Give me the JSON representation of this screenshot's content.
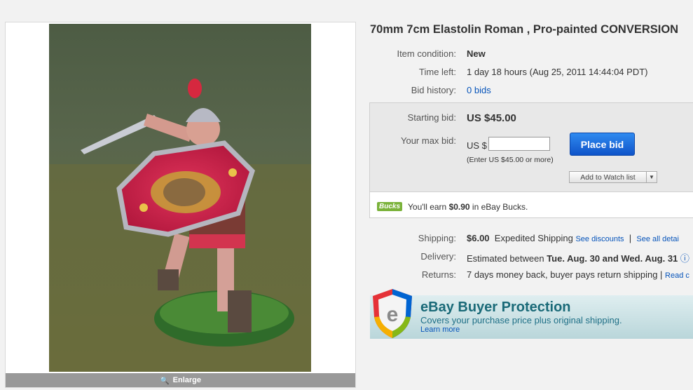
{
  "gallery": {
    "enlarge_label": "Enlarge"
  },
  "listing": {
    "title": "70mm 7cm Elastolin Roman , Pro-painted CONVERSION",
    "condition_label": "Item condition:",
    "condition_value": "New",
    "time_left_label": "Time left:",
    "time_left_value": "1 day 18 hours (Aug 25, 2011 14:44:04 PDT)",
    "bid_history_label": "Bid history:",
    "bid_history_value": "0 bids"
  },
  "bid": {
    "starting_label": "Starting bid:",
    "starting_value": "US $45.00",
    "max_bid_label": "Your max bid:",
    "currency_prefix": "US $",
    "input_value": "",
    "place_bid_label": "Place bid",
    "hint": "(Enter US $45.00 or more)",
    "watch_label": "Add to Watch list"
  },
  "bucks": {
    "logo_text": "Bucks",
    "text_prefix": "You'll earn ",
    "amount": "$0.90",
    "text_suffix": " in eBay Bucks."
  },
  "shipping": {
    "shipping_label": "Shipping:",
    "shipping_cost": "$6.00",
    "shipping_method": "Expedited Shipping",
    "see_discounts": "See discounts",
    "separator": "|",
    "see_all": "See all detai",
    "delivery_label": "Delivery:",
    "delivery_prefix": "Estimated between",
    "delivery_dates": "Tue. Aug. 30 and Wed. Aug. 31",
    "returns_label": "Returns:",
    "returns_text": "7 days money back, buyer pays return shipping |",
    "returns_link": "Read c"
  },
  "protection": {
    "title": "eBay Buyer Protection",
    "subtitle": "Covers your purchase price plus original shipping.",
    "learn_more": "Learn more"
  },
  "colors": {
    "link": "#0654ba",
    "button_blue": "#1769d8",
    "bucks_green": "#7ab23a",
    "protection_teal": "#1a6a78"
  }
}
